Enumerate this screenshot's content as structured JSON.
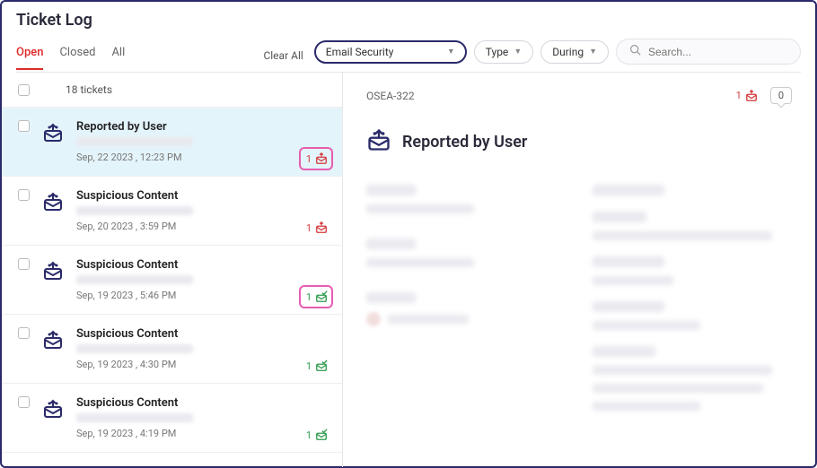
{
  "header": {
    "title": "Ticket Log",
    "tabs": [
      {
        "label": "Open",
        "active": true
      },
      {
        "label": "Closed",
        "active": false
      },
      {
        "label": "All",
        "active": false
      }
    ],
    "clear_all": "Clear All",
    "filters": {
      "category": "Email Security",
      "type": "Type",
      "during": "During"
    },
    "search_placeholder": "Search..."
  },
  "list": {
    "count_label": "18 tickets",
    "rows": [
      {
        "title": "Reported by User",
        "date": "Sep, 22 2023 , 12:23 PM",
        "badge_count": "1",
        "badge_style": "red",
        "highlighted": true,
        "selected": true
      },
      {
        "title": "Suspicious Content",
        "date": "Sep, 20 2023 , 3:59 PM",
        "badge_count": "1",
        "badge_style": "red",
        "highlighted": false,
        "selected": false
      },
      {
        "title": "Suspicious Content",
        "date": "Sep, 19 2023 , 5:46 PM",
        "badge_count": "1",
        "badge_style": "green",
        "highlighted": true,
        "selected": false
      },
      {
        "title": "Suspicious Content",
        "date": "Sep, 19 2023 , 4:30 PM",
        "badge_count": "1",
        "badge_style": "green",
        "highlighted": false,
        "selected": false
      },
      {
        "title": "Suspicious Content",
        "date": "Sep, 19 2023 , 4:19 PM",
        "badge_count": "1",
        "badge_style": "green",
        "highlighted": false,
        "selected": false
      }
    ]
  },
  "detail": {
    "ticket_id": "OSEA-322",
    "top_badge": "1",
    "zero_badge": "0",
    "title": "Reported by User"
  }
}
